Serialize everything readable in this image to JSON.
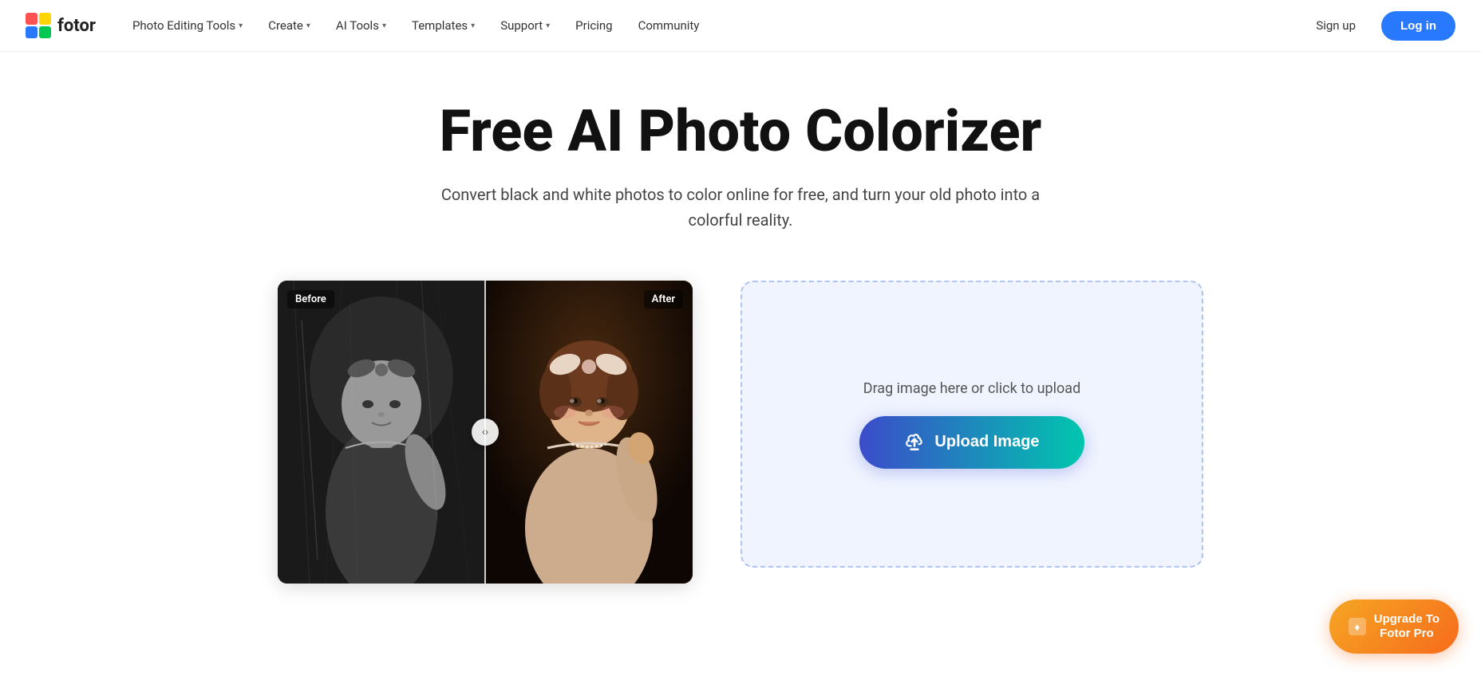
{
  "brand": {
    "logo_text": "fotor",
    "logo_alt": "Fotor logo"
  },
  "nav": {
    "items": [
      {
        "label": "Photo Editing Tools",
        "has_dropdown": true
      },
      {
        "label": "Create",
        "has_dropdown": true
      },
      {
        "label": "AI Tools",
        "has_dropdown": true
      },
      {
        "label": "Templates",
        "has_dropdown": true
      },
      {
        "label": "Support",
        "has_dropdown": true
      },
      {
        "label": "Pricing",
        "has_dropdown": false
      },
      {
        "label": "Community",
        "has_dropdown": false
      }
    ],
    "signup_label": "Sign up",
    "login_label": "Log in"
  },
  "hero": {
    "title": "Free AI Photo Colorizer",
    "subtitle": "Convert black and white photos to color online for free, and turn your old photo into a colorful reality."
  },
  "comparison": {
    "before_label": "Before",
    "after_label": "After"
  },
  "upload": {
    "drag_text": "Drag image here or click to upload",
    "button_label": "Upload Image"
  },
  "upgrade": {
    "line1": "Upgrade To",
    "line2": "Fotor Pro"
  }
}
